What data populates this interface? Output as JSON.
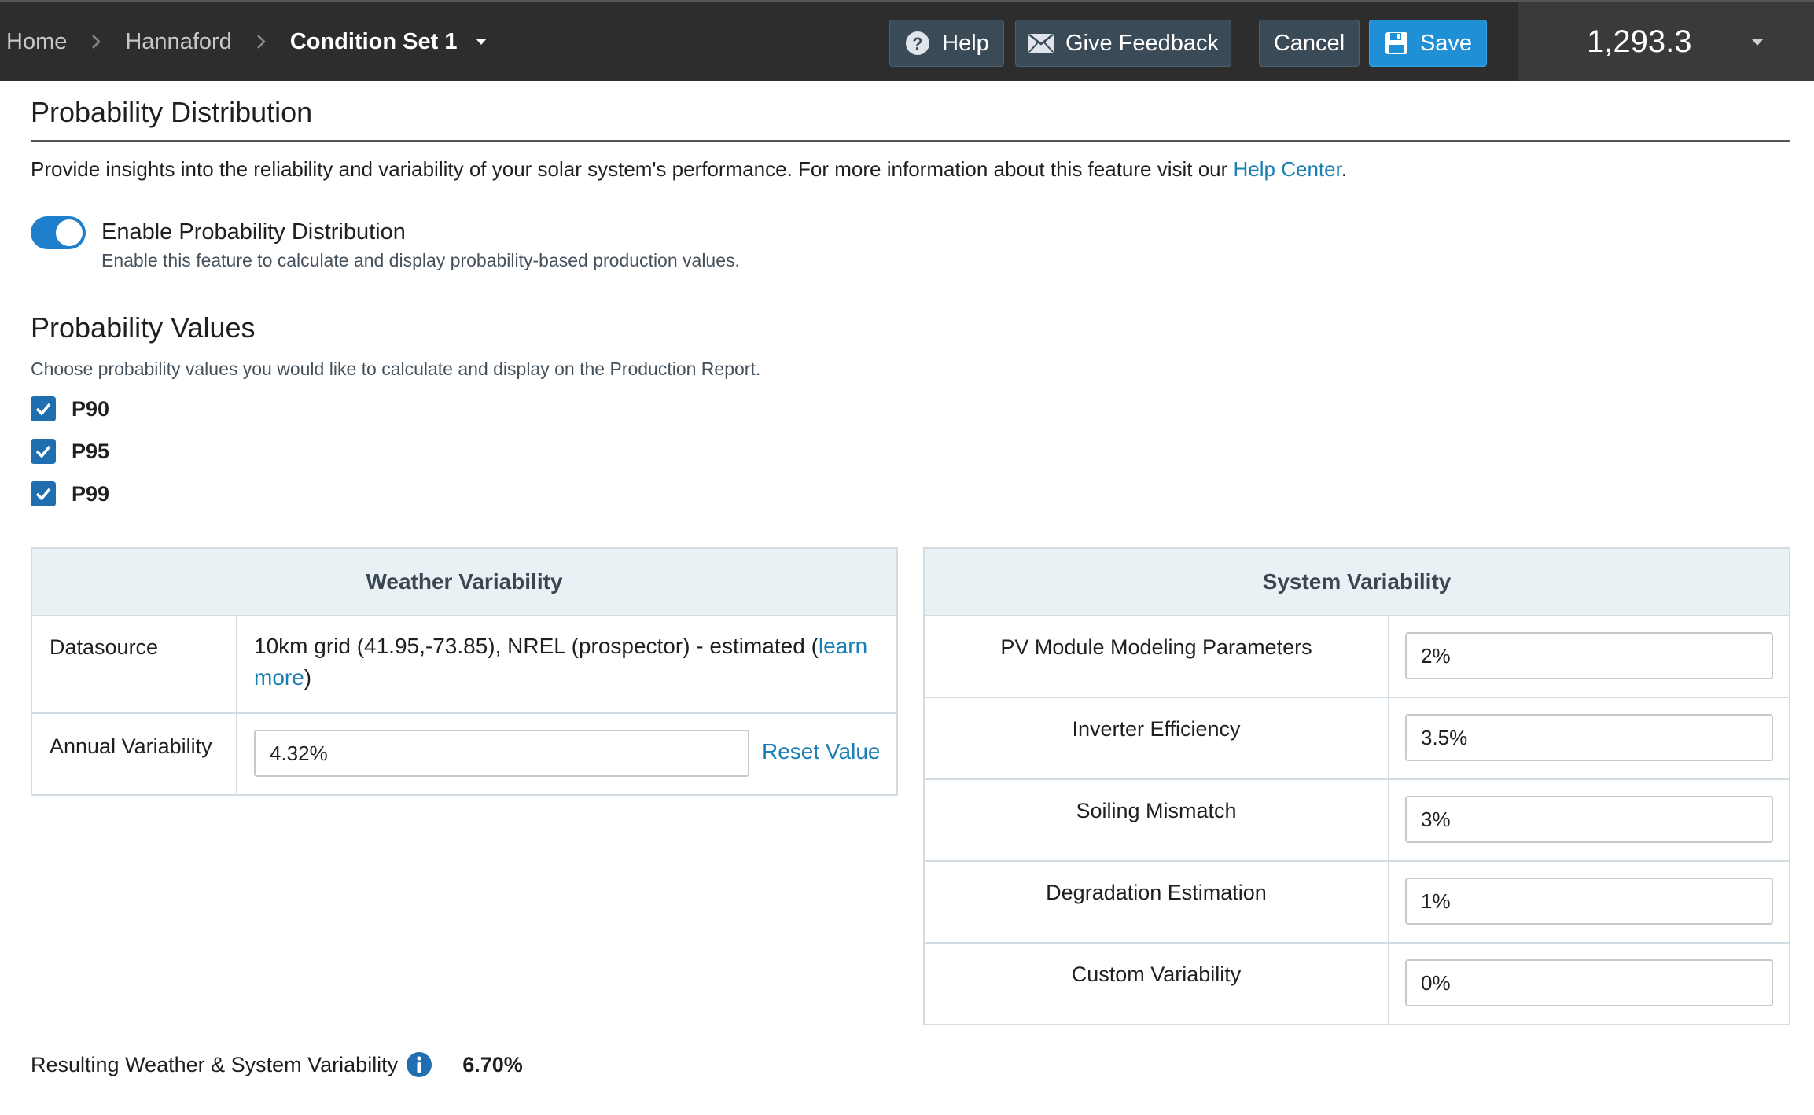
{
  "breadcrumb": {
    "home": "Home",
    "project": "Hannaford",
    "current": "Condition Set 1"
  },
  "header_buttons": {
    "help": "Help",
    "feedback": "Give Feedback",
    "cancel": "Cancel",
    "save": "Save"
  },
  "production_value": "1,293.3",
  "page": {
    "title": "Probability Distribution",
    "intro_text": "Provide insights into the reliability and variability of your solar system's performance. For more information about this feature visit our ",
    "intro_link": "Help Center",
    "intro_end": "."
  },
  "toggle": {
    "label": "Enable Probability Distribution",
    "help": "Enable this feature to calculate and display probability-based production values.",
    "enabled": true
  },
  "probability_values": {
    "title": "Probability Values",
    "description": "Choose probability values you would like to calculate and display on the Production Report.",
    "options": [
      {
        "label": "P90",
        "checked": true
      },
      {
        "label": "P95",
        "checked": true
      },
      {
        "label": "P99",
        "checked": true
      }
    ]
  },
  "weather": {
    "header": "Weather Variability",
    "datasource_label": "Datasource",
    "datasource_text": "10km grid (41.95,-73.85), NREL (prospector) - estimated (",
    "datasource_link_1": "learn",
    "datasource_link_2": "more",
    "datasource_end": ")",
    "annual_label": "Annual Variability",
    "annual_value": "4.32%",
    "reset_label": "Reset Value"
  },
  "system": {
    "header": "System Variability",
    "rows": [
      {
        "label": "PV Module Modeling Parameters",
        "value": "2%"
      },
      {
        "label": "Inverter Efficiency",
        "value": "3.5%"
      },
      {
        "label": "Soiling Mismatch",
        "value": "3%"
      },
      {
        "label": "Degradation Estimation",
        "value": "1%"
      },
      {
        "label": "Custom Variability",
        "value": "0%"
      }
    ]
  },
  "result": {
    "label": "Resulting Weather & System Variability",
    "value": "6.70%"
  },
  "colors": {
    "topbar": "#2d2d2d",
    "accent": "#1f8fd6",
    "link": "#1a7fb5",
    "table_header": "#e9f1f4"
  }
}
